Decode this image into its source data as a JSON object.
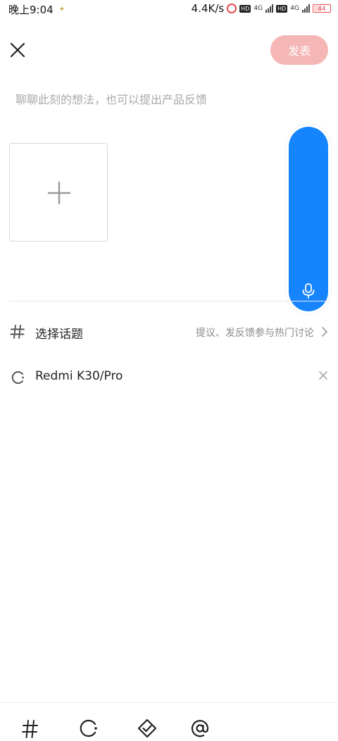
{
  "status_bar": {
    "time": "晚上9:04",
    "speed": "4.4K/s",
    "net_4g_1": "4G",
    "net_4g_2": "4G",
    "hd_1": "HD",
    "hd_2": "HD",
    "battery": "44"
  },
  "header": {
    "close_icon": "close-icon",
    "post_label": "发表",
    "post_color": "#f5b6b6"
  },
  "editor": {
    "placeholder": "聊聊此刻的想法，也可以提出产品反馈",
    "value": ""
  },
  "media": {
    "add_icon": "plus-icon"
  },
  "voice": {
    "icon": "microphone-icon",
    "color": "#1684fc"
  },
  "topic": {
    "label": "选择话题",
    "hint": "提议、发反馈参与热门讨论",
    "icon": "hash-icon"
  },
  "device": {
    "label": "Redmi K30/Pro",
    "icon": "device-circle-icon"
  },
  "toolbar": {
    "items": [
      "hash-icon",
      "device-circle-icon",
      "tag-check-icon",
      "at-icon"
    ]
  }
}
